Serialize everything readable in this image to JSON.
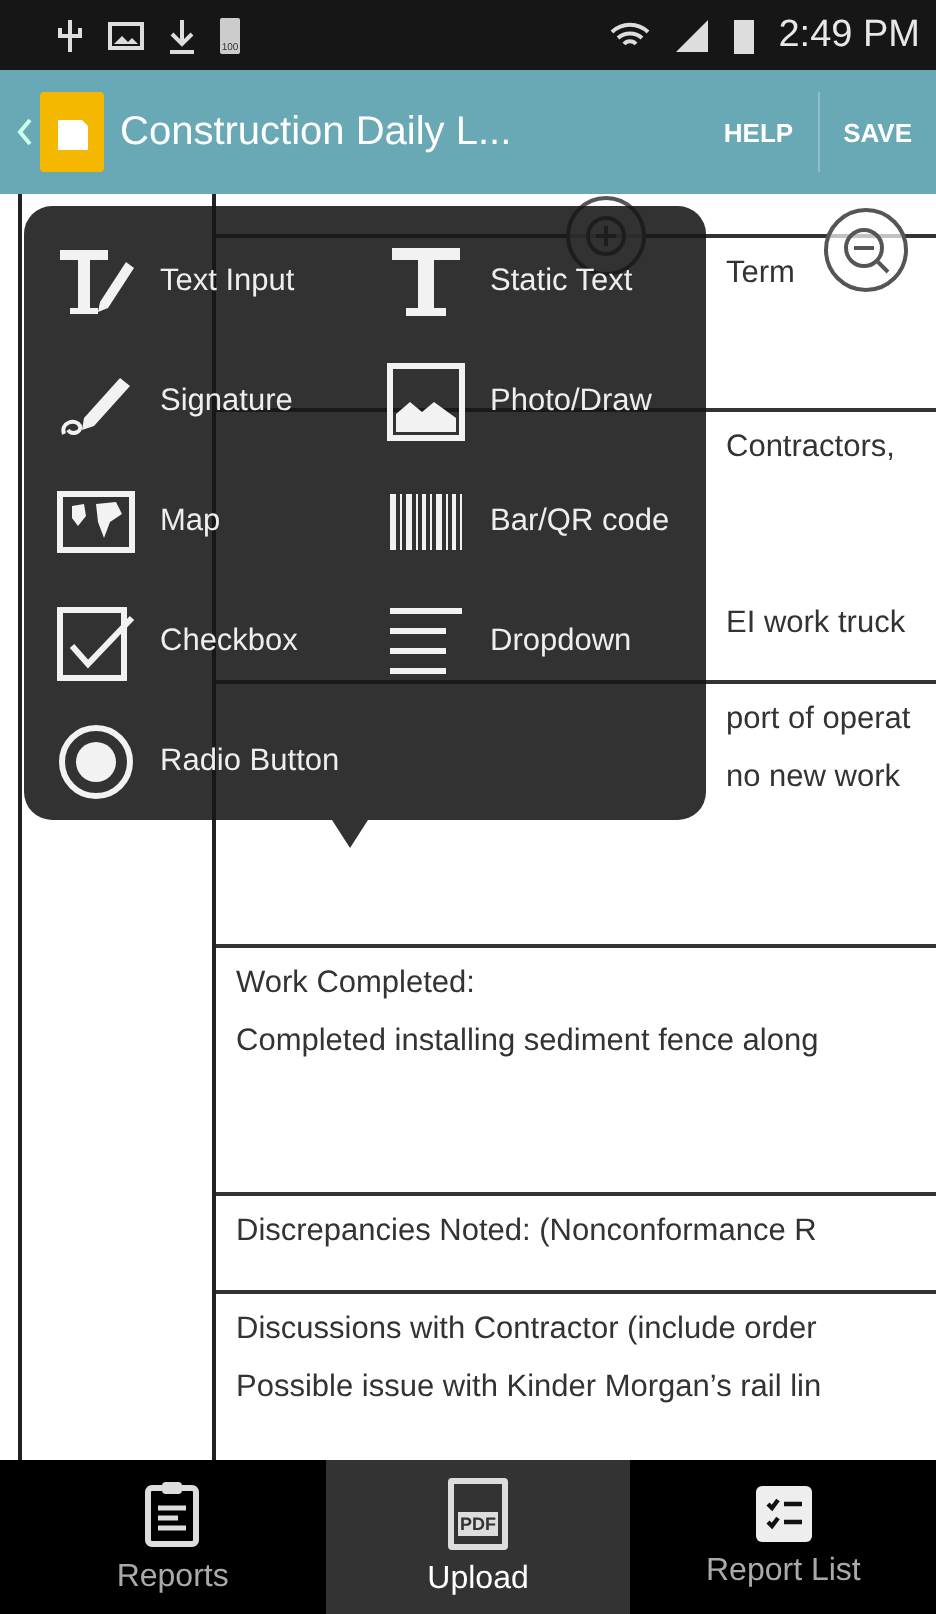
{
  "status_bar": {
    "battery_label": "100",
    "time": "2:49 PM"
  },
  "app_bar": {
    "title": "Construction Daily L...",
    "actions": [
      "HELP",
      "SAVE"
    ]
  },
  "document": {
    "rows": [
      {
        "lines": [
          {
            "text": "Term",
            "clipped": true
          }
        ]
      },
      {
        "lines": [
          {
            "text": "Contractors,",
            "clipped": true
          },
          {
            "text": "EI work truck",
            "clipped": true
          }
        ]
      },
      {
        "lines": [
          {
            "text": "port of operat",
            "clipped": true
          },
          {
            "text": "no new work",
            "clipped": true
          }
        ]
      },
      {
        "lines": [
          {
            "text": "Work Completed:"
          },
          {
            "text": "Completed installing sediment fence along"
          }
        ]
      },
      {
        "lines": [
          {
            "text": "Discrepancies Noted: (Nonconformance R"
          }
        ]
      },
      {
        "lines": [
          {
            "text": "Discussions with Contractor (include order"
          },
          {
            "text": "Possible issue with Kinder Morgan’s rail lin"
          }
        ]
      }
    ]
  },
  "field_menu": {
    "items": [
      {
        "kind": "text_input",
        "label": "Text Input"
      },
      {
        "kind": "static_text",
        "label": "Static Text"
      },
      {
        "kind": "signature",
        "label": "Signature"
      },
      {
        "kind": "photo",
        "label": "Photo/Draw"
      },
      {
        "kind": "map",
        "label": "Map"
      },
      {
        "kind": "barcode",
        "label": "Bar/QR code"
      },
      {
        "kind": "checkbox",
        "label": "Checkbox"
      },
      {
        "kind": "dropdown",
        "label": "Dropdown"
      },
      {
        "kind": "radio",
        "label": "Radio Button"
      }
    ]
  },
  "bottom_nav": {
    "tabs": [
      {
        "kind": "reports",
        "label": "Reports",
        "selected": false
      },
      {
        "kind": "upload",
        "label": "Upload",
        "icon_text": "PDF",
        "selected": true
      },
      {
        "kind": "list",
        "label": "Report List",
        "selected": false
      }
    ]
  }
}
